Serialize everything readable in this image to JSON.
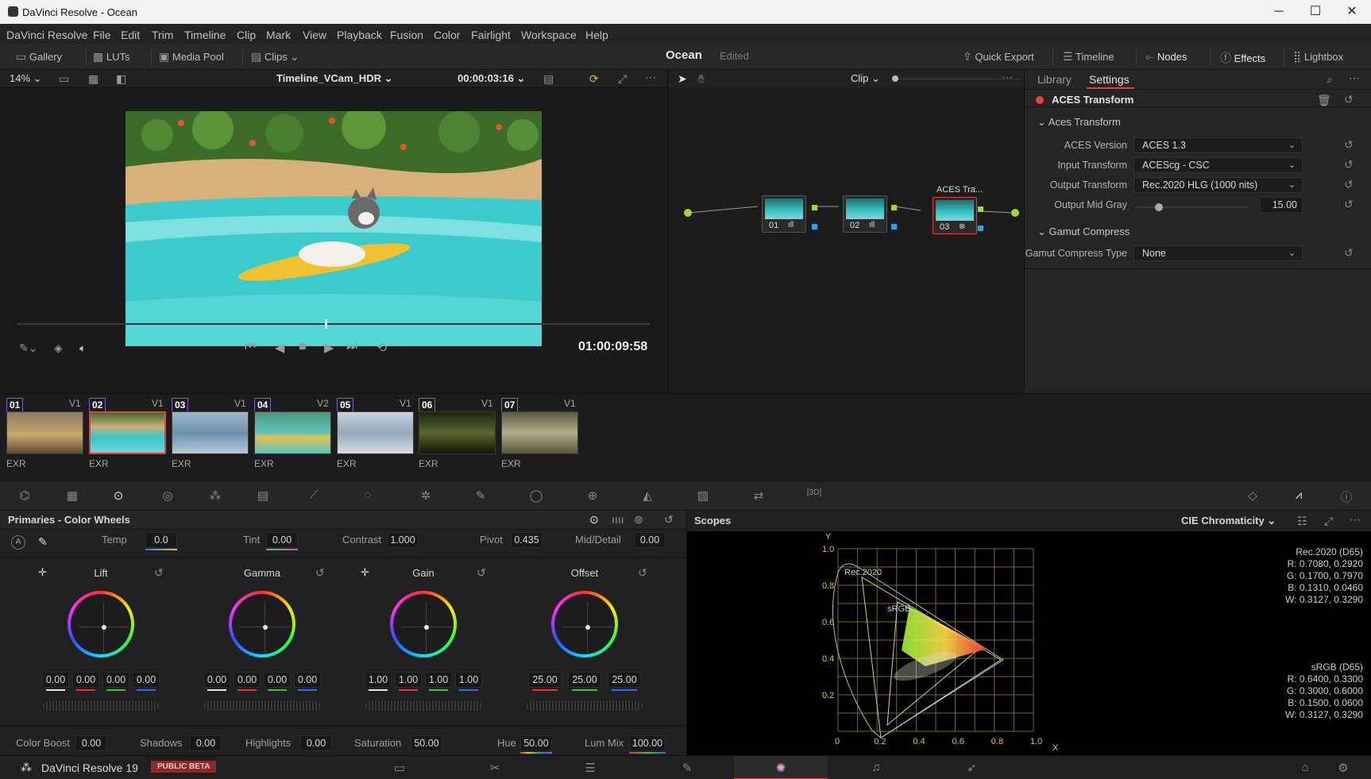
{
  "window": {
    "title": "DaVinci Resolve - Ocean",
    "controls": [
      "─",
      "☐",
      "✕"
    ]
  },
  "menu": [
    "DaVinci Resolve",
    "File",
    "Edit",
    "Trim",
    "Timeline",
    "Clip",
    "Mark",
    "View",
    "Playback",
    "Fusion",
    "Color",
    "Fairlight",
    "Workspace",
    "Help"
  ],
  "toolbar": {
    "left": [
      "Gallery",
      "LUTs",
      "Media Pool",
      "Clips"
    ],
    "project": "Ocean",
    "status": "Edited",
    "right": [
      "Quick Export",
      "Timeline",
      "Nodes",
      "Effects",
      "Lightbox"
    ]
  },
  "viewer": {
    "zoom": "14%",
    "timeline": "Timeline_VCam_HDR",
    "timecode": "00:00:03:16",
    "playhead_tc": "01:00:09:58"
  },
  "nodes": {
    "mode": "Clip",
    "items": [
      {
        "label": "01"
      },
      {
        "label": "02"
      },
      {
        "label": "03",
        "title": "ACES Tra..."
      }
    ]
  },
  "panel": {
    "tabs": [
      "Library",
      "Settings"
    ],
    "active_tab": "Settings",
    "effect": "ACES Transform",
    "section1": "Aces Transform",
    "fields": [
      {
        "label": "ACES Version",
        "value": "ACES 1.3"
      },
      {
        "label": "Input Transform",
        "value": "ACEScg - CSC"
      },
      {
        "label": "Output Transform",
        "value": "Rec.2020 HLG (1000 nits)"
      }
    ],
    "mid_gray": {
      "label": "Output Mid Gray",
      "value": "15.00"
    },
    "section2": "Gamut Compress",
    "gamut": {
      "label": "Gamut Compress Type",
      "value": "None"
    }
  },
  "clips": [
    {
      "num": "01",
      "track": "V1",
      "fmt": "EXR",
      "bg": "linear-gradient(#8a7a63,#c9a86b 55%,#5f4a36)"
    },
    {
      "num": "02",
      "track": "V1",
      "fmt": "EXR",
      "bg": "linear-gradient(#3f6b2e,#cfae79 35%,#39c4c8 60%,#6fd6d8)",
      "selected": true
    },
    {
      "num": "03",
      "track": "V1",
      "fmt": "EXR",
      "bg": "linear-gradient(#9fb7c9,#6c90ab 50%,#b8c9d6)"
    },
    {
      "num": "04",
      "track": "V2",
      "fmt": "EXR",
      "bg": "linear-gradient(#4d9a74,#5cc3c0 50%,#e0c050 60%,#5cc3c0)"
    },
    {
      "num": "05",
      "track": "V1",
      "fmt": "EXR",
      "bg": "linear-gradient(#c7d2dc,#94a9b9 50%,#d8dee4)"
    },
    {
      "num": "06",
      "track": "V1",
      "fmt": "EXR",
      "bg": "linear-gradient(#1c2415,#59662d 50%,#101408)"
    },
    {
      "num": "07",
      "track": "V1",
      "fmt": "EXR",
      "bg": "linear-gradient(#5a5945,#b3ad8c 50%,#55553c)"
    }
  ],
  "primaries": {
    "title": "Primaries - Color Wheels",
    "top": [
      {
        "label": "Temp",
        "value": "0.0"
      },
      {
        "label": "Tint",
        "value": "0.00"
      },
      {
        "label": "Contrast",
        "value": "1.000"
      },
      {
        "label": "Pivot",
        "value": "0.435"
      },
      {
        "label": "Mid/Detail",
        "value": "0.00"
      }
    ],
    "wheels": [
      {
        "name": "Lift",
        "values": [
          "0.00",
          "0.00",
          "0.00",
          "0.00"
        ]
      },
      {
        "name": "Gamma",
        "values": [
          "0.00",
          "0.00",
          "0.00",
          "0.00"
        ]
      },
      {
        "name": "Gain",
        "values": [
          "1.00",
          "1.00",
          "1.00",
          "1.00"
        ]
      },
      {
        "name": "Offset",
        "values": [
          "25.00",
          "25.00",
          "25.00"
        ]
      }
    ],
    "bottom": [
      {
        "label": "Color Boost",
        "value": "0.00"
      },
      {
        "label": "Shadows",
        "value": "0.00"
      },
      {
        "label": "Highlights",
        "value": "0.00"
      },
      {
        "label": "Saturation",
        "value": "50.00"
      },
      {
        "label": "Hue",
        "value": "50.00"
      },
      {
        "label": "Lum Mix",
        "value": "100.00"
      }
    ]
  },
  "scopes": {
    "title": "Scopes",
    "mode": "CIE Chromaticity",
    "y_axis": "Y",
    "x_axis": "X",
    "y_ticks": [
      "1.0",
      "0.8",
      "0.6",
      "0.4",
      "0.2"
    ],
    "x_ticks": [
      "0",
      "0.2",
      "0.4",
      "0.6",
      "0.8",
      "1.0"
    ],
    "labels": {
      "rec2020": "Rec.2020",
      "srgb": "sRGB"
    },
    "rec2020_info": [
      "Rec.2020 (D65)",
      "R: 0.7080, 0.2920",
      "G: 0.1700, 0.7970",
      "B: 0.1310, 0.0460",
      "W: 0.3127, 0.3290"
    ],
    "srgb_info": [
      "sRGB (D65)",
      "R: 0.6400, 0.3300",
      "G: 0.3000, 0.6000",
      "B: 0.1500, 0.0600",
      "W: 0.3127, 0.3290"
    ]
  },
  "bottom": {
    "app": "DaVinci Resolve 19",
    "badge": "PUBLIC BETA"
  }
}
